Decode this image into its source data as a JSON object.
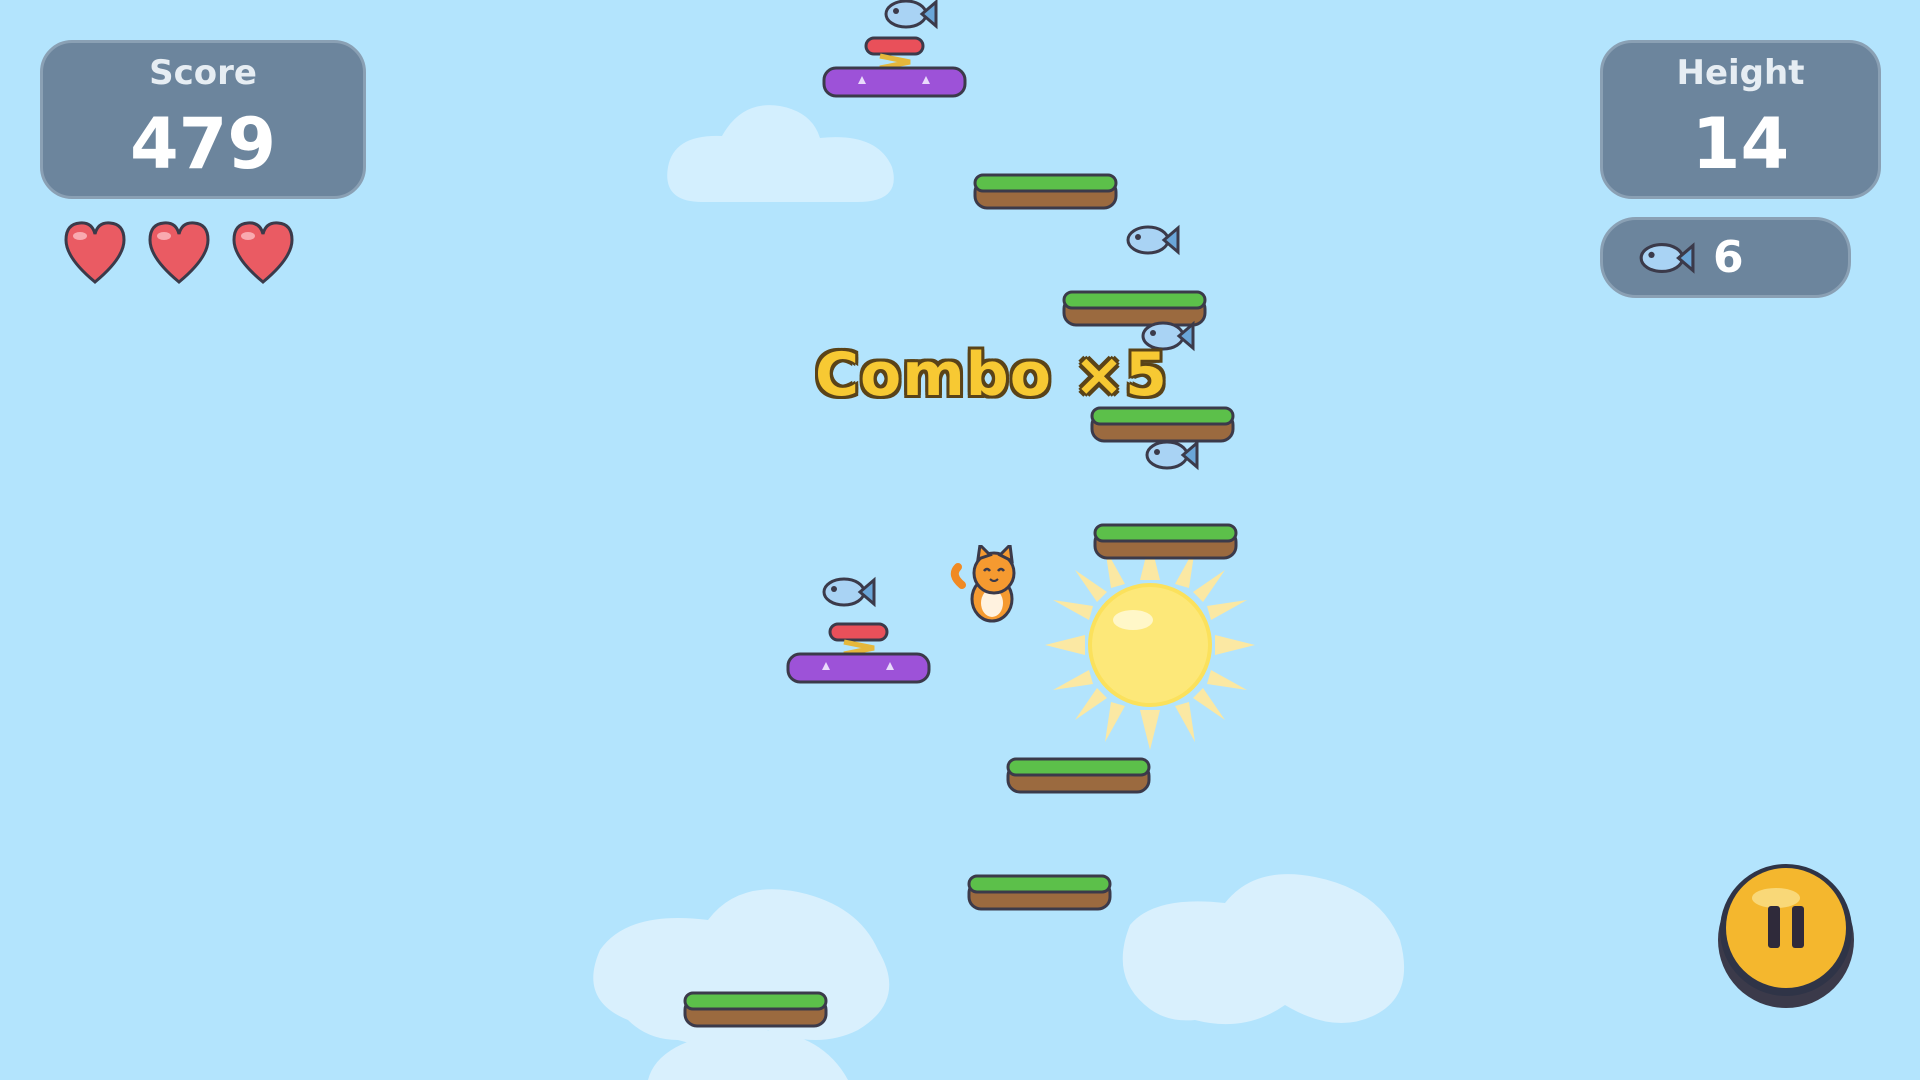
{
  "hud": {
    "score_label": "Score",
    "score_value": "479",
    "height_label": "Height",
    "height_value": "14",
    "fish_count": "6",
    "lives": 3
  },
  "combo_text": "Combo ×5",
  "colors": {
    "sky": "#b3e4fd",
    "panel": "#6c859d",
    "heart": "#ea5b63",
    "grass": "#5cc04a",
    "dirt": "#9b6a3f",
    "spring_platform": "#9d52d8",
    "combo_text": "#f7c933",
    "pause_button": "#f4b72e"
  },
  "icons": {
    "life": "heart-icon",
    "collectible": "fish-icon",
    "pause": "pause-icon",
    "player": "orange-cat",
    "powerup": "sun-icon"
  }
}
